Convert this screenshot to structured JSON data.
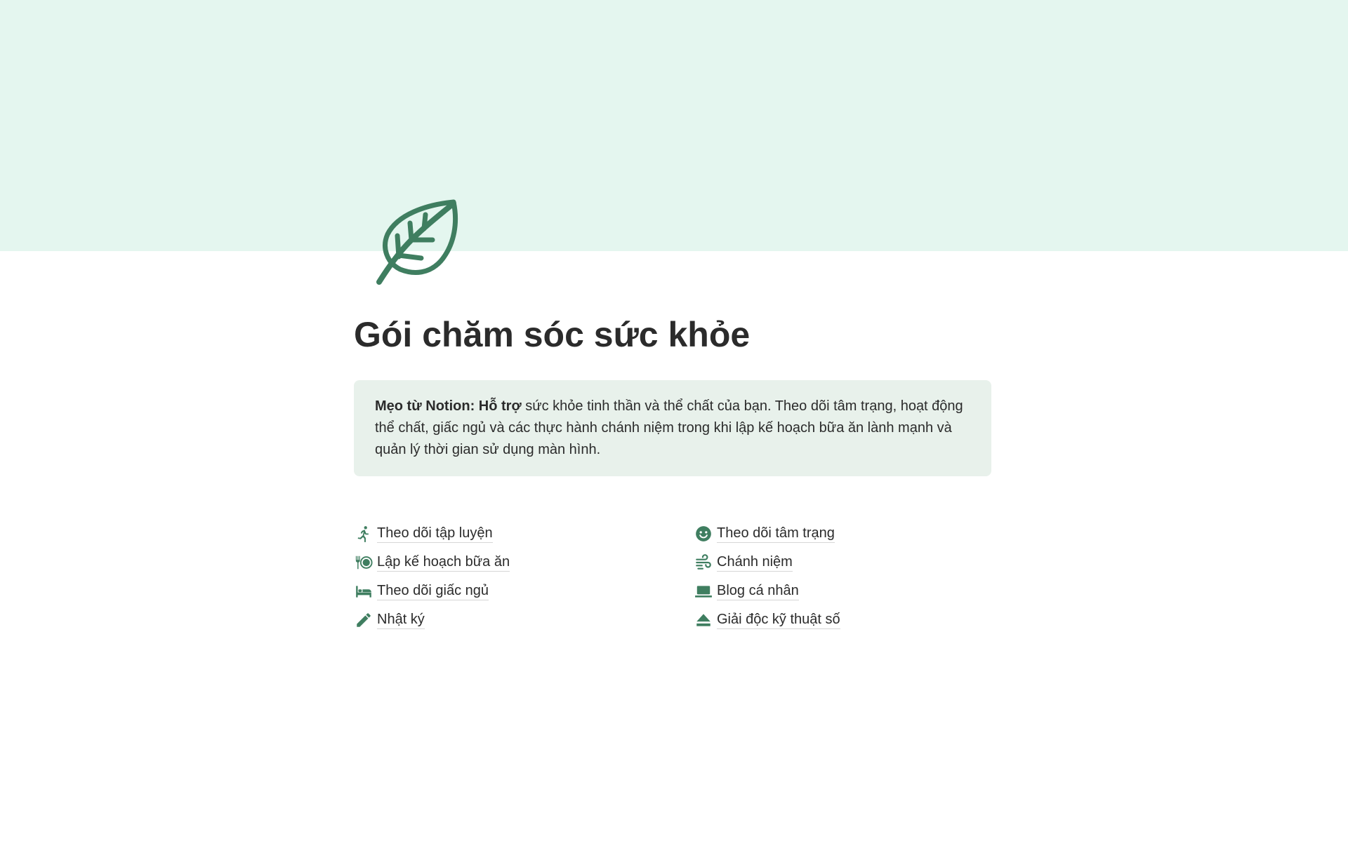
{
  "cover": {
    "color": "#e4f6ef"
  },
  "page": {
    "icon": "leaf-icon",
    "title": "Gói chăm sóc sức khỏe"
  },
  "callout": {
    "bold": "Mẹo từ Notion: Hỗ trợ",
    "text": " sức khỏe tinh thần và thể chất của bạn. Theo dõi tâm trạng, hoạt động thể chất, giấc ngủ và các thực hành chánh niệm trong khi lập kế hoạch bữa ăn lành mạnh và quản lý thời gian sử dụng màn hình."
  },
  "accent_color": "#3f7e60",
  "links": {
    "left": [
      {
        "icon": "running-icon",
        "label": "Theo dõi tập luyện"
      },
      {
        "icon": "dining-icon",
        "label": "Lập kế hoạch bữa ăn"
      },
      {
        "icon": "bed-icon",
        "label": "Theo dõi giấc ngủ"
      },
      {
        "icon": "pencil-icon",
        "label": "Nhật ký"
      }
    ],
    "right": [
      {
        "icon": "smiley-icon",
        "label": "Theo dõi tâm trạng"
      },
      {
        "icon": "wind-icon",
        "label": "Chánh niệm"
      },
      {
        "icon": "laptop-icon",
        "label": "Blog cá nhân"
      },
      {
        "icon": "eject-icon",
        "label": "Giải độc kỹ thuật số"
      }
    ]
  }
}
